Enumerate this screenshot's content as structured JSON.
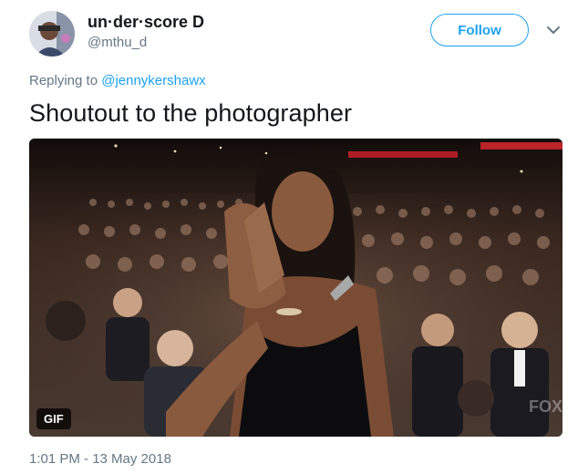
{
  "author": {
    "display_name": "un·der·score D",
    "handle": "@mthu_d",
    "avatar_icon": "profile-avatar"
  },
  "follow_label": "Follow",
  "menu_icon": "chevron-down-icon",
  "reply": {
    "prefix": "Replying to",
    "mention": "@jennykershawx"
  },
  "tweet_text": "Shoutout to the photographer",
  "media": {
    "badge": "GIF",
    "watermark": "FOX"
  },
  "timestamp": "1:01 PM - 13 May 2018",
  "colors": {
    "accent": "#1da1f2",
    "secondary_text": "#657786",
    "primary_text": "#14171a"
  }
}
